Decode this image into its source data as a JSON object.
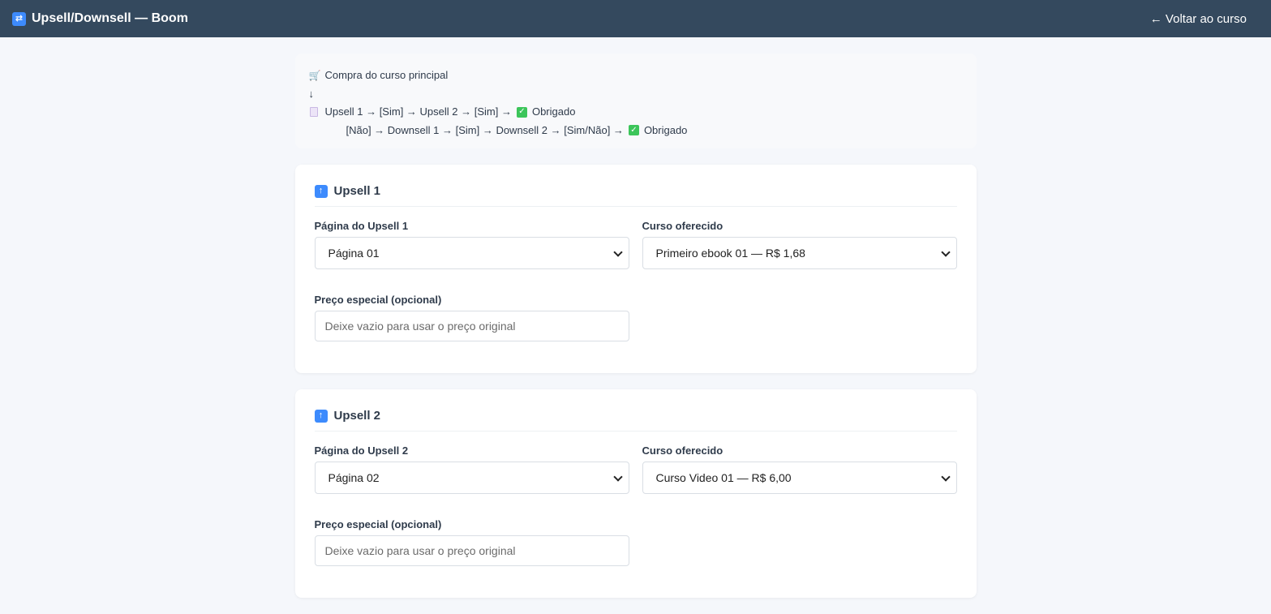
{
  "topbar": {
    "title": "Upsell/Downsell — Boom",
    "back_label": "← Voltar ao curso"
  },
  "flow": {
    "line1": "Compra do curso principal",
    "line2": "↓",
    "line3a": "Upsell 1 → [Sim] → Upsell 2 → [Sim] →",
    "line3b": "Obrigado",
    "line4a": "[Não] → Downsell 1 → [Sim] → Downsell 2 → [Sim/Não] →",
    "line4b": "Obrigado"
  },
  "cards": [
    {
      "title": "Upsell 1",
      "page_label": "Página do Upsell 1",
      "page_value": "Página 01",
      "course_label": "Curso oferecido",
      "course_value": "Primeiro ebook 01 — R$ 1,68",
      "price_label": "Preço especial (opcional)",
      "price_placeholder": "Deixe vazio para usar o preço original"
    },
    {
      "title": "Upsell 2",
      "page_label": "Página do Upsell 2",
      "page_value": "Página 02",
      "course_label": "Curso oferecido",
      "course_value": "Curso Video 01 — R$ 6,00",
      "price_label": "Preço especial (opcional)",
      "price_placeholder": "Deixe vazio para usar o preço original"
    }
  ],
  "colors": {
    "topbar": "#34495e",
    "accent": "#3d8bfd",
    "check": "#3cc55a"
  }
}
